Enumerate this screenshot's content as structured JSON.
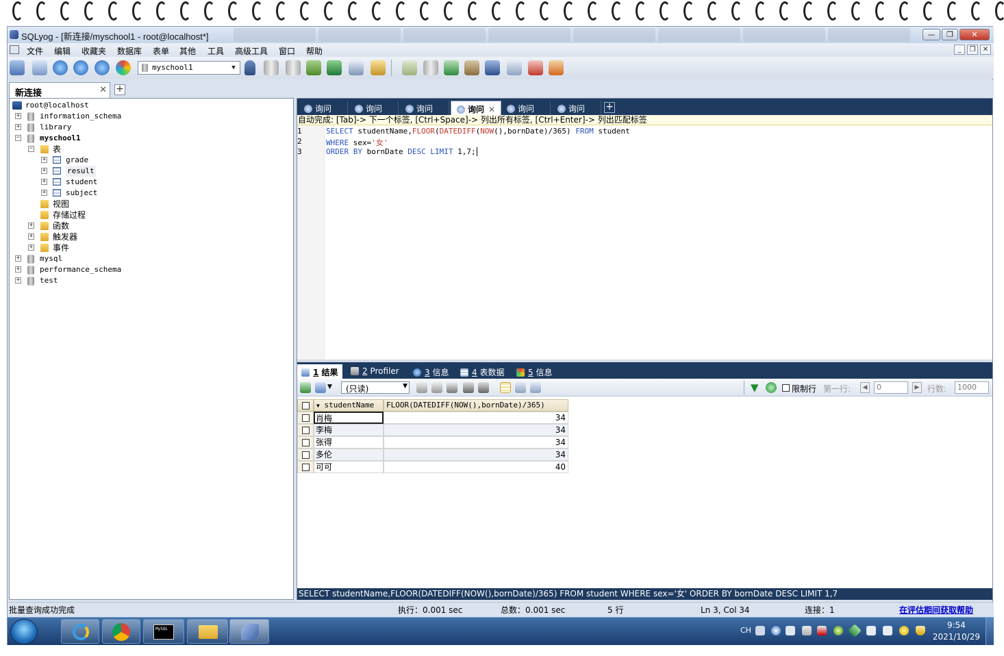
{
  "window": {
    "title": "SQLyog - [新连接/myschool1 - root@localhost*]",
    "min_label": "—",
    "max_label": "❐",
    "close_label": "✕"
  },
  "menu": [
    "文件",
    "编辑",
    "收藏夹",
    "数据库",
    "表单",
    "其他",
    "工具",
    "高级工具",
    "窗口",
    "帮助"
  ],
  "toolbar": {
    "database_select": "myschool1"
  },
  "connection_tab": {
    "label": "新连接",
    "close": "✕",
    "add": "+"
  },
  "object_browser": {
    "root": "root@localhost",
    "nodes": {
      "information_schema": "information_schema",
      "library": "library",
      "myschool1": "myschool1",
      "tables_folder": "表",
      "grade": "grade",
      "result": "result",
      "student": "student",
      "subject": "subject",
      "views": "视图",
      "procs": "存储过程",
      "functions": "函数",
      "triggers": "触发器",
      "events": "事件",
      "mysql": "mysql",
      "performance_schema": "performance_schema",
      "test": "test"
    },
    "plus": "+",
    "minus": "−"
  },
  "query_tabs": [
    {
      "label": "询问"
    },
    {
      "label": "询问"
    },
    {
      "label": "询问"
    },
    {
      "label": "询问",
      "active": true
    },
    {
      "label": "询问"
    },
    {
      "label": "询问"
    }
  ],
  "query_tab_close": "✕",
  "query_tab_add": "+",
  "autocomplete_tip": "自动完成: [Tab]-> 下一个标签, [Ctrl+Space]-> 列出所有标签, [Ctrl+Enter]-> 列出匹配标签",
  "editor": {
    "line_numbers": [
      "1",
      "2",
      "3"
    ],
    "line1": {
      "kw1": "SELECT",
      "t1": " studentName,",
      "fn1": "FLOOR",
      "t2": "(",
      "fn2": "DATEDIFF",
      "t3": "(",
      "fn3": "NOW",
      "t4": "(),bornDate)/365) ",
      "kw2": "FROM",
      "t5": " student"
    },
    "line2": {
      "kw1": "WHERE",
      "t1": " sex=",
      "str1": "'女'"
    },
    "line3": {
      "kw1": "ORDER BY",
      "t1": " bornDate ",
      "kw2": "DESC",
      "t2": " ",
      "kw3": "LIMIT",
      "t3": " 1,7;"
    }
  },
  "result_tabs": [
    {
      "num": "1",
      "label": "结果"
    },
    {
      "num": "2",
      "label": "Profiler"
    },
    {
      "num": "3",
      "label": "信息"
    },
    {
      "num": "4",
      "label": "表数据"
    },
    {
      "num": "5",
      "label": "信息"
    }
  ],
  "result_toolbar": {
    "mode_select": "(只读)",
    "limit_rows_label": "限制行",
    "first_row_label": "第一行:",
    "first_row_value": "0",
    "row_count_label": "行数:",
    "row_count_value": "1000",
    "arrow_left": "◀",
    "arrow_right": "▶"
  },
  "result_grid": {
    "columns": [
      "studentName",
      "FLOOR(DATEDIFF(NOW(),bornDate)/365)"
    ],
    "sort_indicator": "▼",
    "rows": [
      [
        "肖梅",
        "34"
      ],
      [
        "李梅",
        "34"
      ],
      [
        "张得",
        "34"
      ],
      [
        "多伦",
        "34"
      ],
      [
        "可可",
        "40"
      ]
    ]
  },
  "sql_status": "SELECT studentName,FLOOR(DATEDIFF(NOW(),bornDate)/365) FROM student WHERE sex='女' ORDER BY bornDate DESC LIMIT 1,7",
  "statusbar": {
    "message": "批量查询成功完成",
    "exec": "执行：0.001 sec",
    "total": "总数：0.001 sec",
    "rows": "5 行",
    "position": "Ln 3, Col 34",
    "connections": "连接：1",
    "help_link": "在评估期间获取帮助"
  },
  "taskbar": {
    "lang": "CH",
    "time": "9:54",
    "date": "2021/10/29"
  },
  "colors": {
    "dark_tab_bar": "#1e3a5f",
    "keyword": "#2a52be",
    "function": "#c0392b",
    "link": "#0000cc"
  }
}
